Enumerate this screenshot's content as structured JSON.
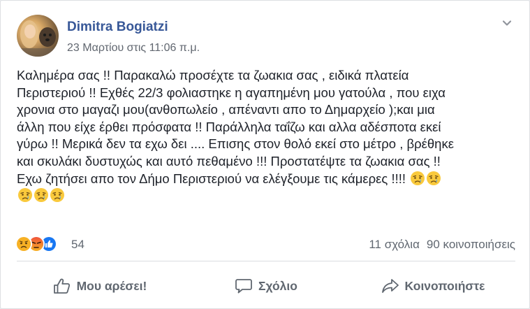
{
  "post": {
    "author": "Dimitra Bogiatzi",
    "timestamp": "23 Μαρτίου στις 11:06 π.μ.",
    "menu_icon": "chevron-down-icon",
    "text_lines": [
      "Καλημέρα σας !! Παρακαλώ προσέχτε τα ζωακια σας , ειδικά πλατεία",
      "Περιστεριού !! Εχθές 22/3 φολιαστηκε η αγαπημένη μου γατούλα , που ειχα",
      "χρονια στο μαγαζι μου(ανθοπωλείο , απέναντι απο το Δημαρχείο );και μια",
      "άλλη που είχε έρθει πρόσφατα !! Παράλληλα ταΐζω και αλλα αδέσποτα εκεί",
      "γύρω !! Μερικά δεν τα εχω δει .... Επισης στον θολό εκεί στο μέτρο , βρέθηκε",
      "και σκυλάκι δυστυχώς και αυτό πεθαμένο !!! Προστατέψτε τα ζωακια σας !!",
      "Εχω ζητήσει απο τον Δήμο Περιστεριού να ελέγξουμε τις κάμερες !!!! "
    ],
    "emoji": "crying-face-emoji"
  },
  "reactions": {
    "icons": [
      "sad-reaction-icon",
      "angry-reaction-icon",
      "like-reaction-icon"
    ],
    "count": "54",
    "comments": "11 σχόλια",
    "shares": "90 κοινοποιήσεις"
  },
  "actions": {
    "like_label": "Μου αρέσει!",
    "comment_label": "Σχόλιο",
    "share_label": "Κοινοποιήστε"
  },
  "colors": {
    "author": "#385898",
    "secondary_text": "#606770",
    "like_blue": "#1877f2",
    "angry_orange": "#f0523a",
    "sad_yellow": "#f7b125"
  }
}
